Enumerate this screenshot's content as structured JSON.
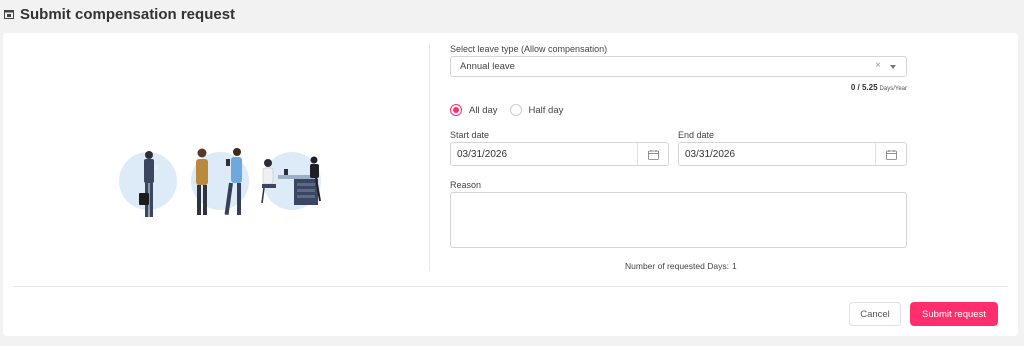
{
  "page": {
    "title": "Submit compensation request"
  },
  "form": {
    "leave_type_label": "Select leave type (Allow compensation)",
    "leave_type_value": "Annual leave",
    "clear_glyph": "×",
    "balance": {
      "used": "0 / 5.25",
      "unit": "Days/Year"
    },
    "duration_options": [
      {
        "label": "All day",
        "selected": true
      },
      {
        "label": "Half day",
        "selected": false
      }
    ],
    "start_date_label": "Start date",
    "start_date_value": "03/31/2026",
    "end_date_label": "End date",
    "end_date_value": "03/31/2026",
    "reason_label": "Reason",
    "reason_value": "",
    "requested_days_label": "Number of requested Days:",
    "requested_days_value": "1"
  },
  "actions": {
    "cancel_label": "Cancel",
    "submit_label": "Submit request"
  },
  "colors": {
    "accent": "#ff2f6d",
    "illustration_bg": "#dcebf7"
  }
}
